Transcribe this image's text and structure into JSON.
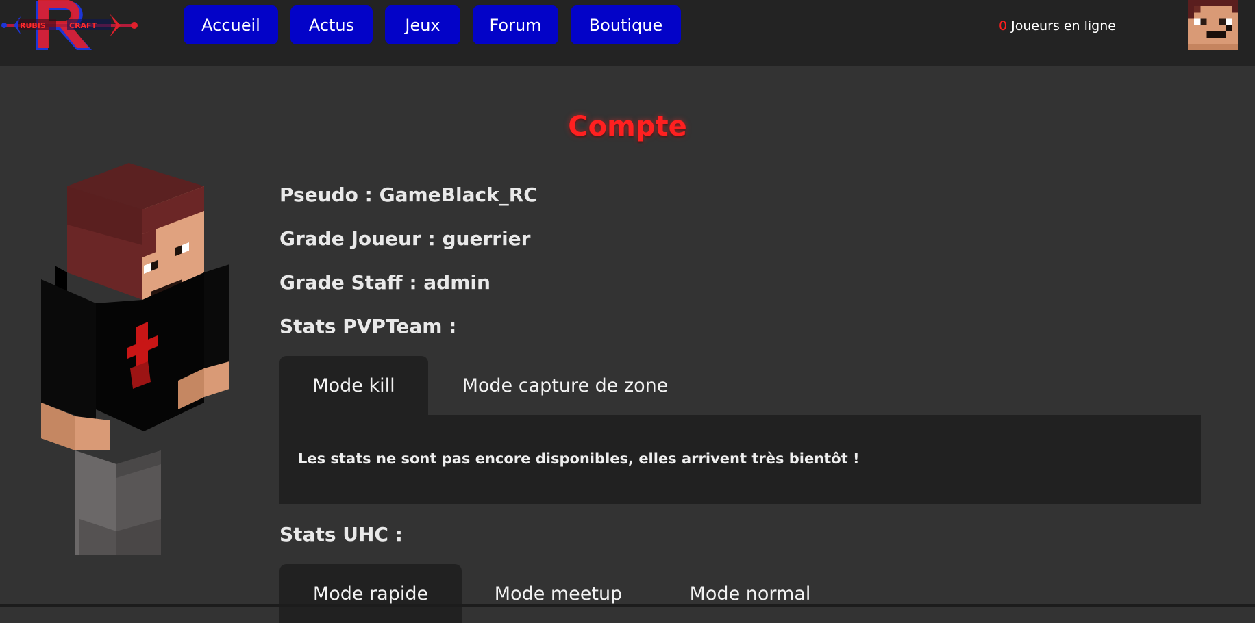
{
  "header": {
    "logo_alt": "RubisCraft",
    "nav": [
      {
        "label": "Accueil"
      },
      {
        "label": "Actus"
      },
      {
        "label": "Jeux"
      },
      {
        "label": "Forum"
      },
      {
        "label": "Boutique"
      }
    ],
    "online_count": "0",
    "online_label": "Joueurs en ligne"
  },
  "colors": {
    "nav_button": "#0303c8",
    "title": "#ff2020",
    "online_count": "#ff1e1e",
    "background": "#333333",
    "topbar": "#232323",
    "panel": "#212121"
  },
  "main": {
    "title": "Compte",
    "pseudo": "Pseudo : GameBlack_RC",
    "grade_joueur": "Grade Joueur : guerrier",
    "grade_staff": "Grade Staff : admin",
    "pvp_title": "Stats PVPTeam :",
    "pvp_tabs": [
      {
        "label": "Mode kill",
        "active": true
      },
      {
        "label": "Mode capture de zone",
        "active": false
      }
    ],
    "pvp_panel_text": "Les stats ne sont pas encore disponibles, elles arrivent très bientôt !",
    "uhc_title": "Stats UHC :",
    "uhc_tabs": [
      {
        "label": "Mode rapide",
        "active": true
      },
      {
        "label": "Mode meetup",
        "active": false
      },
      {
        "label": "Mode normal",
        "active": false
      }
    ]
  }
}
